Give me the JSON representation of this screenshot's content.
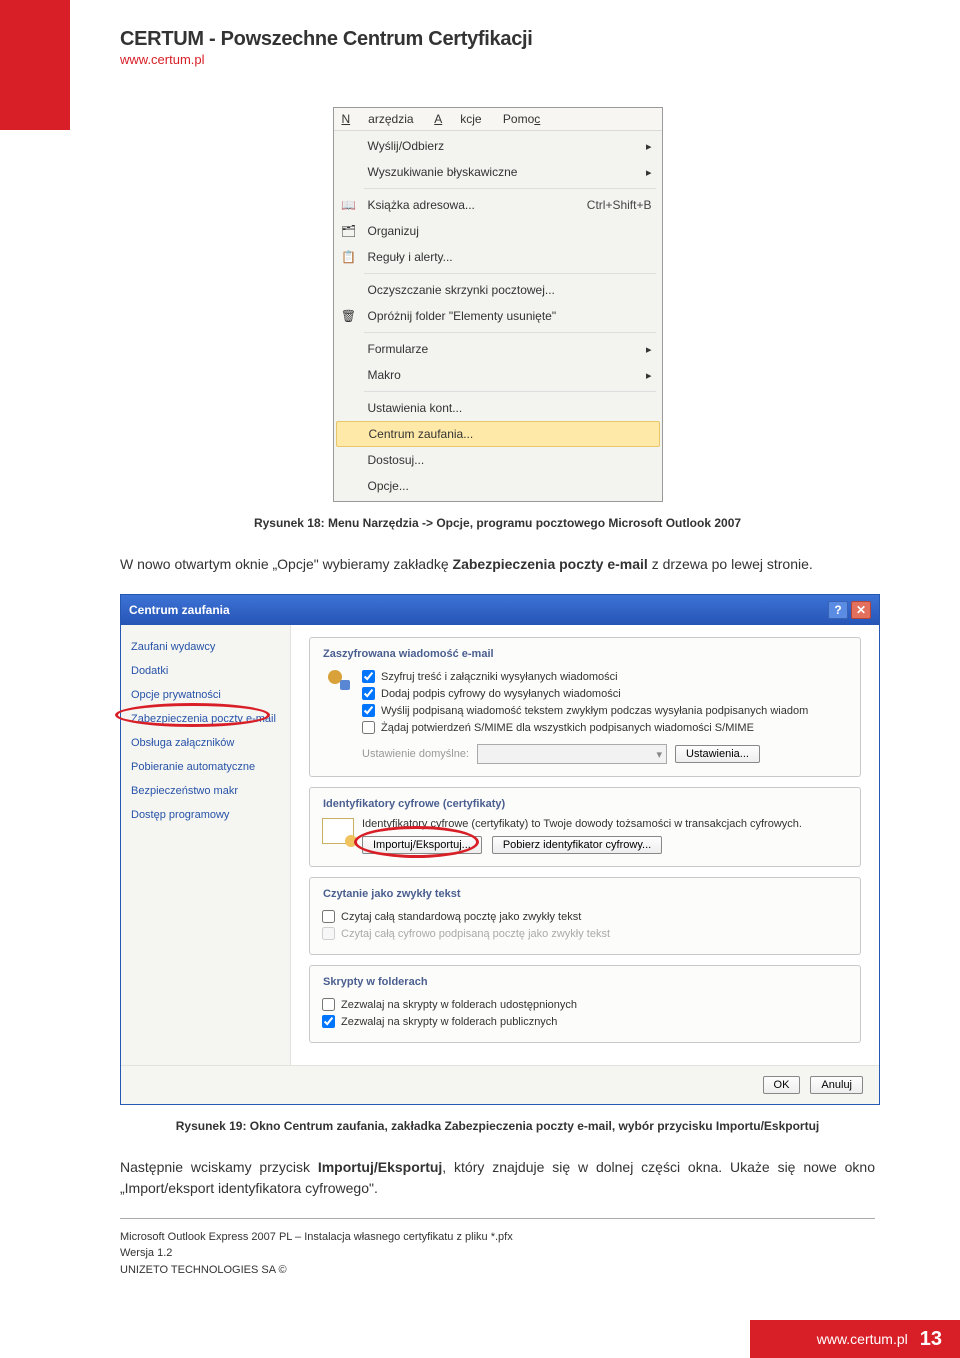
{
  "header": {
    "brand": "CERTUM - Powszechne Centrum Certyfikacji",
    "url": "www.certum.pl"
  },
  "menu": {
    "bar": [
      "Narzędzia",
      "Akcje",
      "Pomoc"
    ],
    "items": [
      {
        "label": "Wyślij/Odbierz",
        "arrow": true,
        "icon": ""
      },
      {
        "label": "Wyszukiwanie błyskawiczne",
        "arrow": true,
        "icon": ""
      },
      {
        "label": "Książka adresowa...",
        "shortcut": "Ctrl+Shift+B",
        "icon": "📖",
        "sepBefore": true
      },
      {
        "label": "Organizuj",
        "icon": "🗂"
      },
      {
        "label": "Reguły i alerty...",
        "icon": "📋"
      },
      {
        "label": "Oczyszczanie skrzynki pocztowej...",
        "sepBefore": true
      },
      {
        "label": "Opróżnij folder \"Elementy usunięte\"",
        "icon": "🗑"
      },
      {
        "label": "Formularze",
        "arrow": true,
        "sepBefore": true
      },
      {
        "label": "Makro",
        "arrow": true
      },
      {
        "label": "Ustawienia kont...",
        "sepBefore": true
      },
      {
        "label": "Centrum zaufania...",
        "highlight": true
      },
      {
        "label": "Dostosuj..."
      },
      {
        "label": "Opcje..."
      }
    ]
  },
  "fig18": {
    "prefix": "Rysunek 18: ",
    "text": "Menu Narzędzia -> Opcje,  programu pocztowego Microsoft Outlook 2007"
  },
  "para1_pre": "W nowo otwartym oknie „Opcje\" wybieramy zakładkę ",
  "para1_bold": "Zabezpieczenia poczty e-mail",
  "para1_post": " z drzewa po lewej stronie.",
  "dialog": {
    "title": "Centrum zaufania",
    "sidebar": [
      "Zaufani wydawcy",
      "Dodatki",
      "Opcje prywatności",
      "Zabezpieczenia poczty e-mail",
      "Obsługa załączników",
      "Pobieranie automatyczne",
      "Bezpieczeństwo makr",
      "Dostęp programowy"
    ],
    "g1": {
      "title": "Zaszyfrowana wiadomość e-mail",
      "chk": [
        "Szyfruj treść i załączniki wysyłanych wiadomości",
        "Dodaj podpis cyfrowy do wysyłanych wiadomości",
        "Wyślij podpisaną wiadomość tekstem zwykłym podczas wysyłania podpisanych wiadom",
        "Żądaj potwierdzeń S/MIME dla wszystkich podpisanych wiadomości S/MIME"
      ],
      "cfg_label": "Ustawienie domyślne:",
      "cfg_btn": "Ustawienia..."
    },
    "g2": {
      "title": "Identyfikatory cyfrowe (certyfikaty)",
      "desc": "Identyfikatory cyfrowe (certyfikaty) to Twoje dowody tożsamości w transakcjach cyfrowych.",
      "btn1": "Importuj/Eksportuj...",
      "btn2": "Pobierz identyfikator cyfrowy..."
    },
    "g3": {
      "title": "Czytanie jako zwykły tekst",
      "chk": [
        "Czytaj całą standardową pocztę jako zwykły tekst",
        "Czytaj całą cyfrowo podpisaną pocztę jako zwykły tekst"
      ]
    },
    "g4": {
      "title": "Skrypty w folderach",
      "chk": [
        "Zezwalaj na skrypty w folderach udostępnionych",
        "Zezwalaj na skrypty w folderach publicznych"
      ]
    },
    "footer": {
      "ok": "OK",
      "cancel": "Anuluj"
    }
  },
  "fig19": {
    "prefix": "Rysunek 19: ",
    "text": "Okno Centrum zaufania, zakładka Zabezpieczenia poczty e-mail, wybór przycisku Importu/Eskportuj"
  },
  "para2_pre": "Następnie wciskamy przycisk ",
  "para2_bold": "Importuj/Eksportuj",
  "para2_post": ", który znajduje się w dolnej części okna. Ukaże się nowe okno „Import/eksport identyfikatora cyfrowego\".",
  "footer": {
    "l1": "Microsoft Outlook Express 2007 PL – Instalacja własnego certyfikatu  z pliku *.pfx",
    "l2": "Wersja 1.2",
    "l3": "UNIZETO TECHNOLOGIES SA ©",
    "url": "www.certum.pl",
    "page": "13"
  }
}
